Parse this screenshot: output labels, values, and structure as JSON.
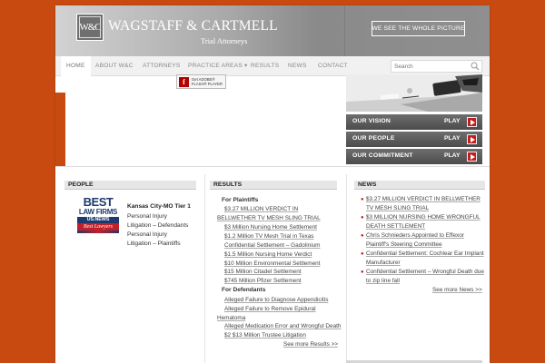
{
  "brand": {
    "logo_text": "W&C",
    "firm_name": "WAGSTAFF & CARTMELL",
    "firm_subtitle": "Trial Attorneys",
    "tagline": "WE SEE THE WHOLE PICTURE",
    "accent_color": "#c94a10"
  },
  "nav": {
    "items": [
      "HOME",
      "ABOUT W&C",
      "ATTORNEYS",
      "PRACTICE AREAS ▾",
      "RESULTS",
      "NEWS",
      "CONTACT"
    ],
    "active": "HOME"
  },
  "search": {
    "placeholder": "Search",
    "value": ""
  },
  "flash": {
    "icon": "f",
    "text_line1": "Get ADOBE®",
    "text_line2": "FLASH® PLAYER"
  },
  "promos": [
    {
      "label": "OUR VISION",
      "action": "PLAY"
    },
    {
      "label": "OUR PEOPLE",
      "action": "PLAY"
    },
    {
      "label": "OUR COMMITMENT",
      "action": "PLAY"
    }
  ],
  "people": {
    "header": "PEOPLE",
    "badge": {
      "line1": "BEST",
      "line2": "LAW FIRMS",
      "line3": "US.NEWS",
      "line4": "Best Lawyers"
    },
    "region": "Kansas City-MO Tier 1",
    "practices": [
      "Personal Injury Litigation – Defendants",
      "Personal Injury Litigation – Plaintiffs"
    ]
  },
  "results": {
    "header": "RESULTS",
    "plaintiffs_title": "For Plaintiffs",
    "plaintiffs": [
      "$3.27 MILLION VERDICT IN BELLWETHER TV MESH SLING TRIAL",
      "$3 Million Nursing Home Settlement",
      "$1.2 Million TV Mesh Trial in Texas",
      "Confidential Settlement – Gadolinium",
      "$1.5 Million Nursing Home Verdict",
      "$10 Million Environmental Settlement",
      "$15 Million Citadel Settlement",
      "$745 Million Pfizer Settlement"
    ],
    "defendants_title": "For Defendants",
    "defendants": [
      "Alleged Failure to Diagnose Appendicitis",
      "Alleged Failure to Remove Epidural Hematoma",
      "Alleged Medication Error and Wrongful Death",
      "$2 $13 Million Trustee Litigation"
    ],
    "more": "See more Results >>"
  },
  "news": {
    "header": "NEWS",
    "items": [
      "$3.27 MILLION VERDICT IN BELLWETHER TV MESH SLING TRIAL",
      "$3 MILLION NURSING HOME WRONGFUL DEATH SETTLEMENT",
      "Chris Schnieders Appointed to Effexor Plaintiff's Steering Committee",
      "Confidential Settlement: Cochlear Ear Implant Manufacturer",
      "Confidential Settlement – Wrongful Death due to zip line fall"
    ],
    "more": "See more News >>"
  }
}
